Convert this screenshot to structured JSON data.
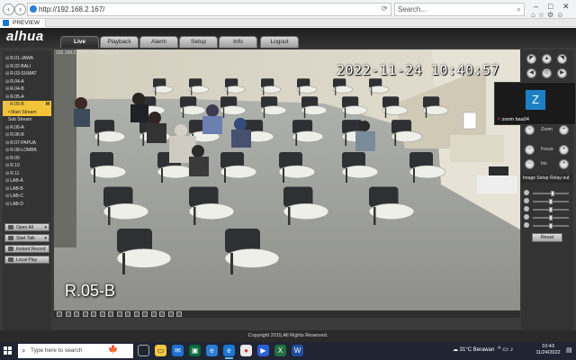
{
  "browser": {
    "url": "http://192.168.2.167/",
    "search_placeholder": "Search...",
    "tab_title": "PREVIEW",
    "window_controls": [
      "–",
      "□",
      "✕"
    ],
    "toolbar_icons": [
      "home-icon",
      "star-icon",
      "gear-icon",
      "smiley-icon"
    ]
  },
  "app": {
    "logo": "alhua",
    "nav_tabs": [
      "Live",
      "Playback",
      "Alarm",
      "Setup",
      "Info",
      "Logout"
    ],
    "active_tab": "Live",
    "channels": [
      {
        "label": "R.01-JAWA"
      },
      {
        "label": "R.02-BALI"
      },
      {
        "label": "R.03-SUMAT"
      },
      {
        "label": "R.04-A"
      },
      {
        "label": "R.04-B"
      },
      {
        "label": "R.05-A"
      },
      {
        "label": "R.05-B",
        "flag": "M",
        "selected": true
      },
      {
        "label": "Main Stream",
        "sub": true,
        "selected": true
      },
      {
        "label": "Sub Stream",
        "sub": true
      },
      {
        "label": "R.06-A"
      },
      {
        "label": "R.06-B"
      },
      {
        "label": "R.07-PAPUA"
      },
      {
        "label": "R.08-LOMBK"
      },
      {
        "label": "R.09"
      },
      {
        "label": "R.10"
      },
      {
        "label": "R.11"
      },
      {
        "label": "LAB-A"
      },
      {
        "label": "LAB-B"
      },
      {
        "label": "LAB-C"
      },
      {
        "label": "LAB-D"
      }
    ],
    "left_buttons": [
      "Open All",
      "Start Talk",
      "Instant Record",
      "Local Play"
    ],
    "video": {
      "info": "192.168.2.167_7_1002Kbps_M",
      "timestamp": "2022-11-24 10:40:57",
      "camera_name": "R.05-B"
    },
    "ptz": {
      "zoom_labels": [
        "Zoom",
        "Focus",
        "Iris"
      ]
    },
    "image_setup": {
      "tabs": [
        "Image Setup",
        "Relay-out"
      ],
      "slider_levels": [
        0.55,
        0.5,
        0.5,
        0.5,
        0.5
      ],
      "reset_label": "Reset"
    },
    "copyright": "Copyright 2015,All Rights Reserved."
  },
  "zoom_overlay": {
    "avatar_letter": "Z",
    "participant": "zoom baa04"
  },
  "taskbar": {
    "search_placeholder": "Type here to search",
    "weather": "31°C  Berawan",
    "time": "10:43",
    "date": "11/24/2022"
  }
}
